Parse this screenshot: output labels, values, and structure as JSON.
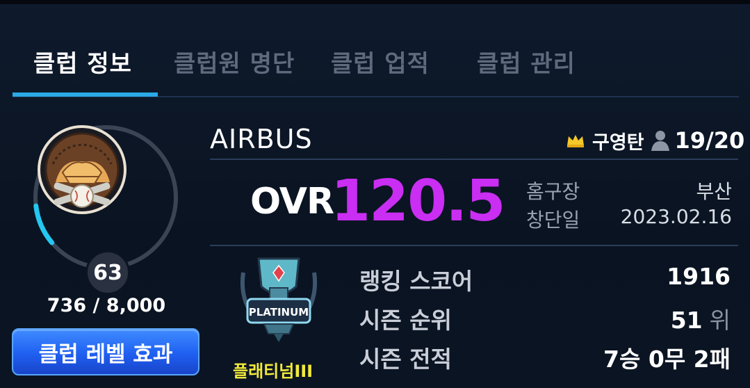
{
  "tabs": [
    {
      "label": "클럽 정보",
      "active": true
    },
    {
      "label": "클럽원 명단",
      "active": false
    },
    {
      "label": "클럽 업적",
      "active": false
    },
    {
      "label": "클럽 관리",
      "active": false
    }
  ],
  "level": {
    "value": "63",
    "exp_text": "736 / 8,000",
    "progress": 0.092,
    "button_label": "클럽 레벨 효과"
  },
  "club": {
    "name": "AIRBUS",
    "owner": "구영탄",
    "members": "19/20",
    "ovr_label": "OVR",
    "ovr_value": "120.5",
    "home_label": "홈구장",
    "home_value": "부산",
    "founded_label": "창단일",
    "founded_value": "2023.02.16"
  },
  "tier": {
    "name": "플래티넘III",
    "badge_text": "PLATINUM"
  },
  "stats": {
    "ranking_label": "랭킹 스코어",
    "ranking_value": "1916",
    "season_rank_label": "시즌 순위",
    "season_rank_value": "51",
    "season_rank_unit": "위",
    "season_record_label": "시즌 전적",
    "season_record_value": "7승 0무 2패"
  },
  "colors": {
    "accent": "#2aa9e6",
    "ovr": "#c92ef2",
    "tier": "#f2ea3a",
    "button": "#1f5ff1"
  },
  "icons": {
    "owner": "crown-icon",
    "members": "person-icon",
    "club_emblem": "handshake-baseball-emblem-icon",
    "tier_emblem": "platinum-trophy-icon"
  }
}
